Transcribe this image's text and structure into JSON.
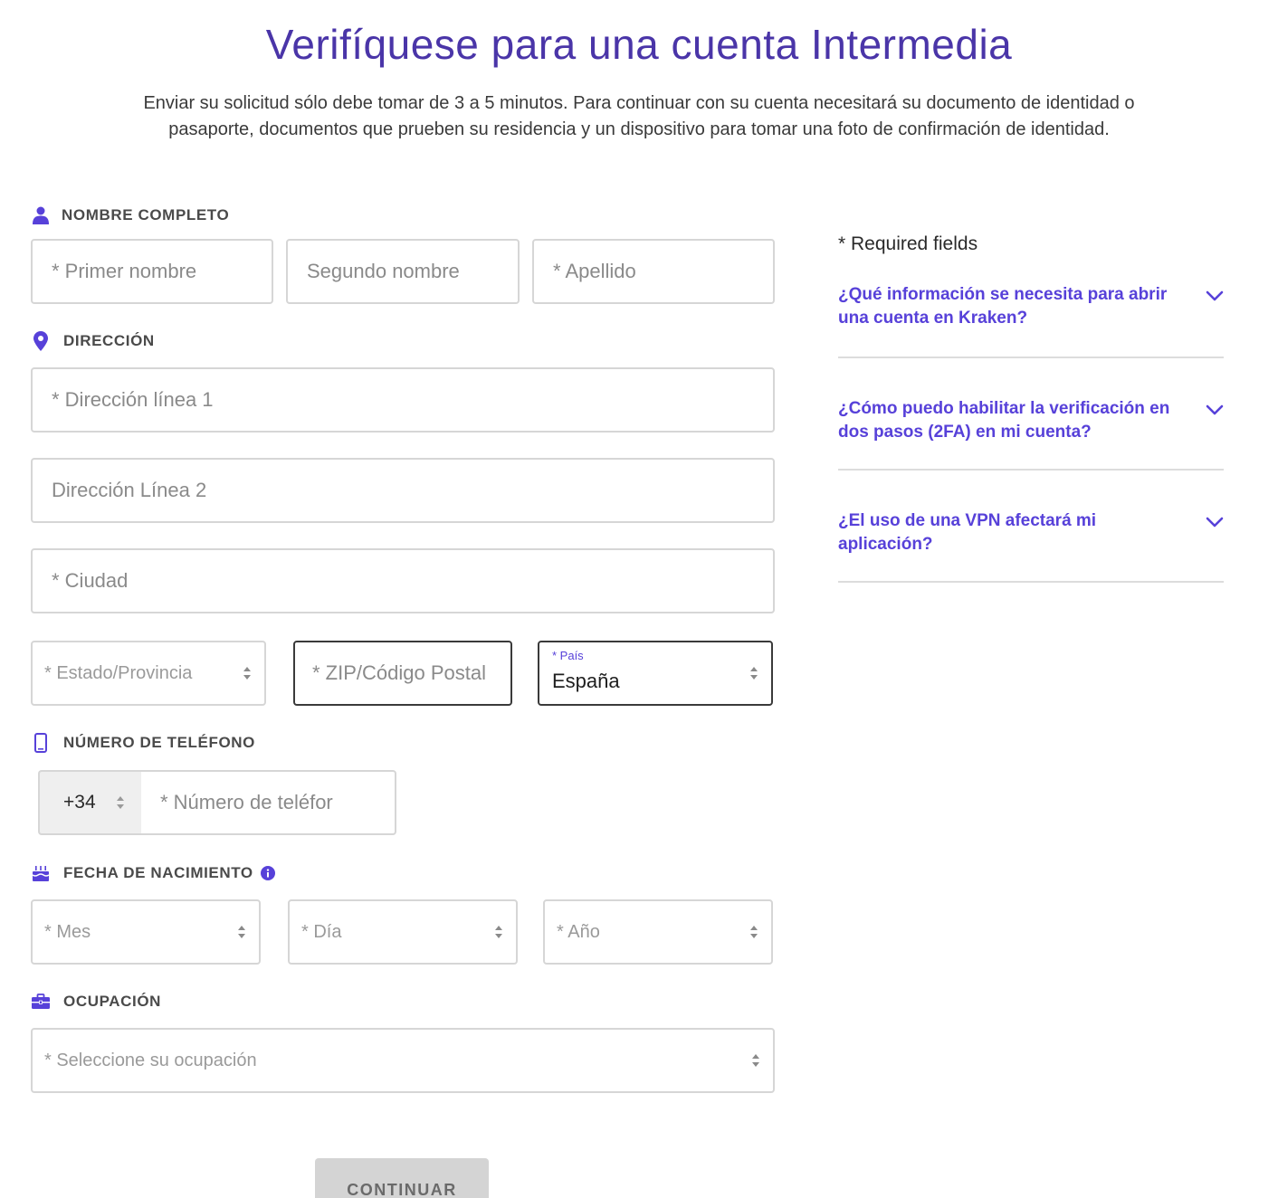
{
  "header": {
    "title": "Verifíquese para una cuenta Intermedia",
    "intro_line1": "Enviar su solicitud sólo debe tomar de 3 a 5 minutos. Para continuar con su cuenta necesitará su documento de identidad o",
    "intro_line2": "pasaporte, documentos que prueben su residencia y un dispositivo para tomar una foto de confirmación de identidad."
  },
  "sections": {
    "name": {
      "label": "NOMBRE COMPLETO",
      "icon": "user-icon"
    },
    "address": {
      "label": "DIRECCIÓN",
      "icon": "map-pin-icon"
    },
    "phone": {
      "label": "NÚMERO DE TELÉFONO",
      "icon": "mobile-phone-icon"
    },
    "birth": {
      "label": "FECHA DE NACIMIENTO",
      "icon": "birthday-cake-icon",
      "info_icon": "info-icon"
    },
    "occupation": {
      "label": "OCUPACIÓN",
      "icon": "briefcase-icon"
    }
  },
  "fields": {
    "first_name": "* Primer nombre",
    "middle_name": "Segundo nombre",
    "last_name": "* Apellido",
    "address1": "* Dirección línea 1",
    "address2": "Dirección Línea 2",
    "city": "* Ciudad",
    "state": "* Estado/Provincia",
    "zip": "* ZIP/Código Postal",
    "country_label": "* País",
    "country_value": "España",
    "phone_prefix": "+34",
    "phone_number": "* Número de teléfor",
    "month": "* Mes",
    "day": "* Día",
    "year": "* Año",
    "occupation": "* Seleccione su ocupación"
  },
  "actions": {
    "continue_label": "CONTINUAR"
  },
  "sidebar": {
    "required_note": "* Required fields",
    "faq": [
      {
        "q_line1": "¿Qué información se necesita para abrir",
        "q_line2": "una cuenta en Kraken?"
      },
      {
        "q_line1": "¿Cómo puedo habilitar la verificación en",
        "q_line2": "dos pasos (2FA) en mi cuenta?"
      },
      {
        "q_line1": "¿El uso de una VPN afectará mi",
        "q_line2": "aplicación?"
      }
    ]
  },
  "colors": {
    "accent": "#5741d9",
    "title": "#4a35a8",
    "border": "#d6d6d6",
    "button_disabled": "#d4d4d4"
  }
}
